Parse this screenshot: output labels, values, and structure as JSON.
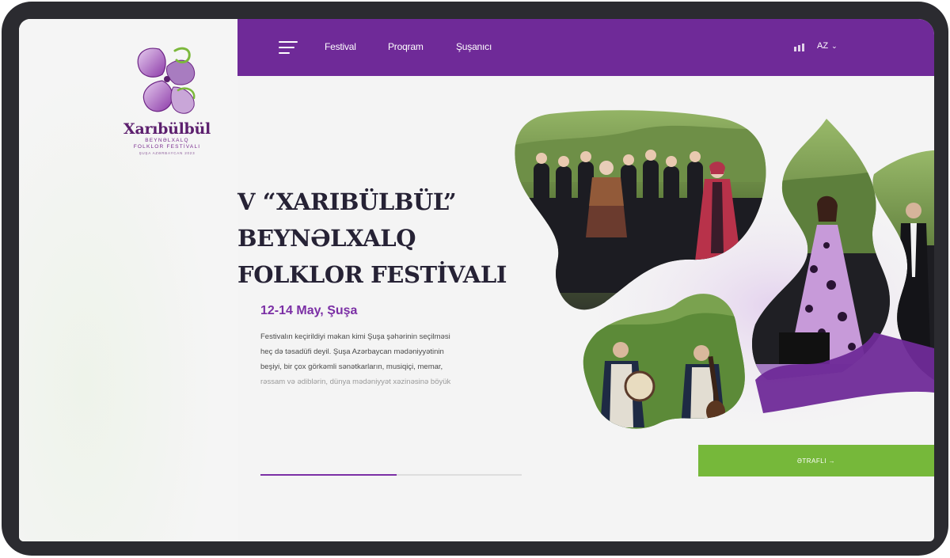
{
  "logo": {
    "title": "Xarıbülbül",
    "line1": "BEYNƏLXALQ",
    "line2": "FOLKLOR FESTİVALI",
    "line3": "ŞUŞA  AZƏRBAYCAN  2023"
  },
  "nav": {
    "items": [
      "Festival",
      "Proqram",
      "Şuşanıcı"
    ],
    "language": "AZ"
  },
  "hero": {
    "title_lines": [
      "V “XARIBÜLBÜL”",
      "BEYNƏLXALQ",
      "FOLKLOR FESTİVALI"
    ],
    "date": "12-14 May, Şuşa",
    "description_lines": [
      "Festivalın keçirildiyi məkan kimi Şuşa şəhərinin seçilməsi",
      "heç də təsadüfi deyil. Şuşa Azərbaycan mədəniyyətinin",
      "beşiyi, bir çox görkəmli sənətkarların, musiqiçi, memar,",
      "rəssam və ədiblərin, dünya mədəniyyət xəzinəsinə böyük"
    ],
    "progress": 0.52
  },
  "cta": {
    "label": "ƏTRAFLI →"
  },
  "colors": {
    "brand_purple": "#6f2a98",
    "accent_purple": "#7b2fa5",
    "cta_green": "#76b83a",
    "title_dark": "#262235"
  },
  "icons": [
    "menu-icon",
    "accessibility-icon",
    "chevron-down-icon",
    "xaribulbul-flower-logo"
  ]
}
